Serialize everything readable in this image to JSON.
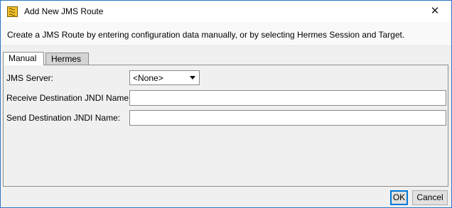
{
  "window": {
    "title": "Add New JMS Route",
    "close_glyph": "✕",
    "app_icon": "jms-route-app-icon"
  },
  "banner": {
    "text": "Create a JMS Route by entering configuration data manually, or by selecting Hermes Session and Target."
  },
  "tabs": [
    {
      "label": "Manual",
      "selected": true
    },
    {
      "label": "Hermes",
      "selected": false
    }
  ],
  "form": {
    "jms_server_label": "JMS Server:",
    "jms_server_value": "<None>",
    "receive_label": "Receive Destination JNDI Name:",
    "receive_value": "",
    "send_label": "Send Destination JNDI Name:",
    "send_value": ""
  },
  "buttons": {
    "ok": "OK",
    "cancel": "Cancel"
  }
}
